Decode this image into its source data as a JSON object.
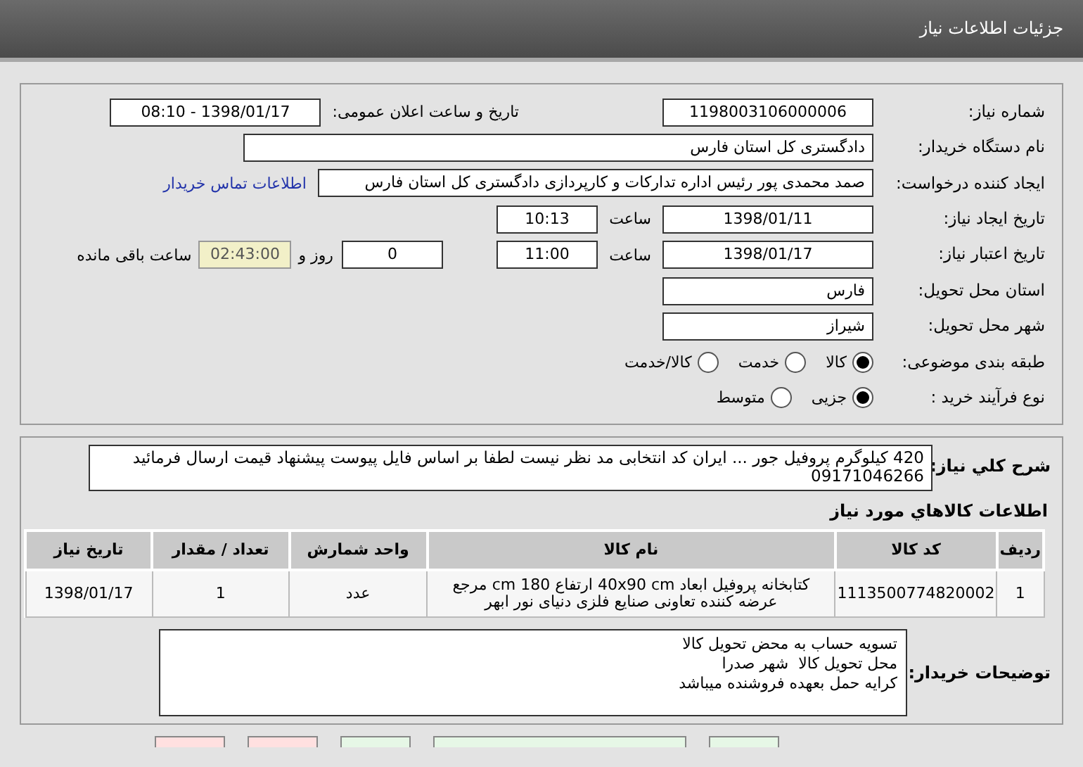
{
  "header": {
    "title": "جزئیات اطلاعات نیاز"
  },
  "details": {
    "need_number": {
      "label": "شماره نیاز:",
      "value": "1198003106000006"
    },
    "announce": {
      "label": "تاریخ و ساعت اعلان عمومی:",
      "value": "1398/01/17 - 08:10"
    },
    "buyer_org": {
      "label": "نام دستگاه خریدار:",
      "value": "دادگستری کل استان فارس"
    },
    "requester": {
      "label": "ایجاد کننده درخواست:",
      "value": "صمد محمدی پور رئیس اداره تدارکات و کارپردازی دادگستری کل استان فارس",
      "link": "اطلاعات تماس خریدار"
    },
    "created": {
      "label": "تاریخ ایجاد نیاز:",
      "date": "1398/01/11",
      "time_label": "ساعت",
      "time": "10:13"
    },
    "valid": {
      "label": "تاریخ اعتبار نیاز:",
      "date": "1398/01/17",
      "time_label": "ساعت",
      "time": "11:00",
      "days": "0",
      "days_label": "روز و",
      "remaining": "02:43:00",
      "remaining_label": "ساعت باقی مانده"
    },
    "province": {
      "label": "استان محل تحویل:",
      "value": "فارس"
    },
    "city": {
      "label": "شهر محل تحویل:",
      "value": "شیراز"
    },
    "category": {
      "label": "طبقه بندی موضوعی:",
      "options": [
        {
          "label": "کالا",
          "selected": true
        },
        {
          "label": "خدمت",
          "selected": false
        },
        {
          "label": "کالا/خدمت",
          "selected": false
        }
      ]
    },
    "process": {
      "label": "نوع فرآیند خرید :",
      "options": [
        {
          "label": "جزیی",
          "selected": true
        },
        {
          "label": "متوسط",
          "selected": false
        }
      ]
    }
  },
  "summary": {
    "label": "شرح کلي نياز:",
    "text": "420 کیلوگرم پروفیل جور ... ایران کد انتخابی مد نظر نیست لطفا بر اساس فایل پیوست پیشنهاد قیمت ارسال فرمائید 09171046266"
  },
  "items": {
    "title": "اطلاعات كالاهاي مورد نياز",
    "columns": [
      "ردیف",
      "کد کالا",
      "نام کالا",
      "واحد شمارش",
      "تعداد / مقدار",
      "تاریخ نیاز"
    ],
    "rows": [
      [
        "1",
        "1113500774820002",
        "کتابخانه پروفیل ابعاد 40x90 cm ارتفاع 180 cm مرجع عرضه کننده تعاونی صنایع فلزی دنیای نور ابهر",
        "عدد",
        "1",
        "1398/01/17"
      ]
    ]
  },
  "notes": {
    "label": "توضیحات خریدار:",
    "lines": [
      "تسویه حساب به محض تحویل کالا",
      "محل تحویل کالا  شهر صدرا",
      "کرایه حمل بعهده فروشنده میباشد"
    ]
  },
  "bottom_buttons": [
    {
      "color": "#ffe0e0"
    },
    {
      "color": "#ffe0e0"
    },
    {
      "color": "#e6f7e6"
    },
    {
      "color": "#e6f7e6"
    },
    {
      "color": "#e6f7e6"
    }
  ]
}
